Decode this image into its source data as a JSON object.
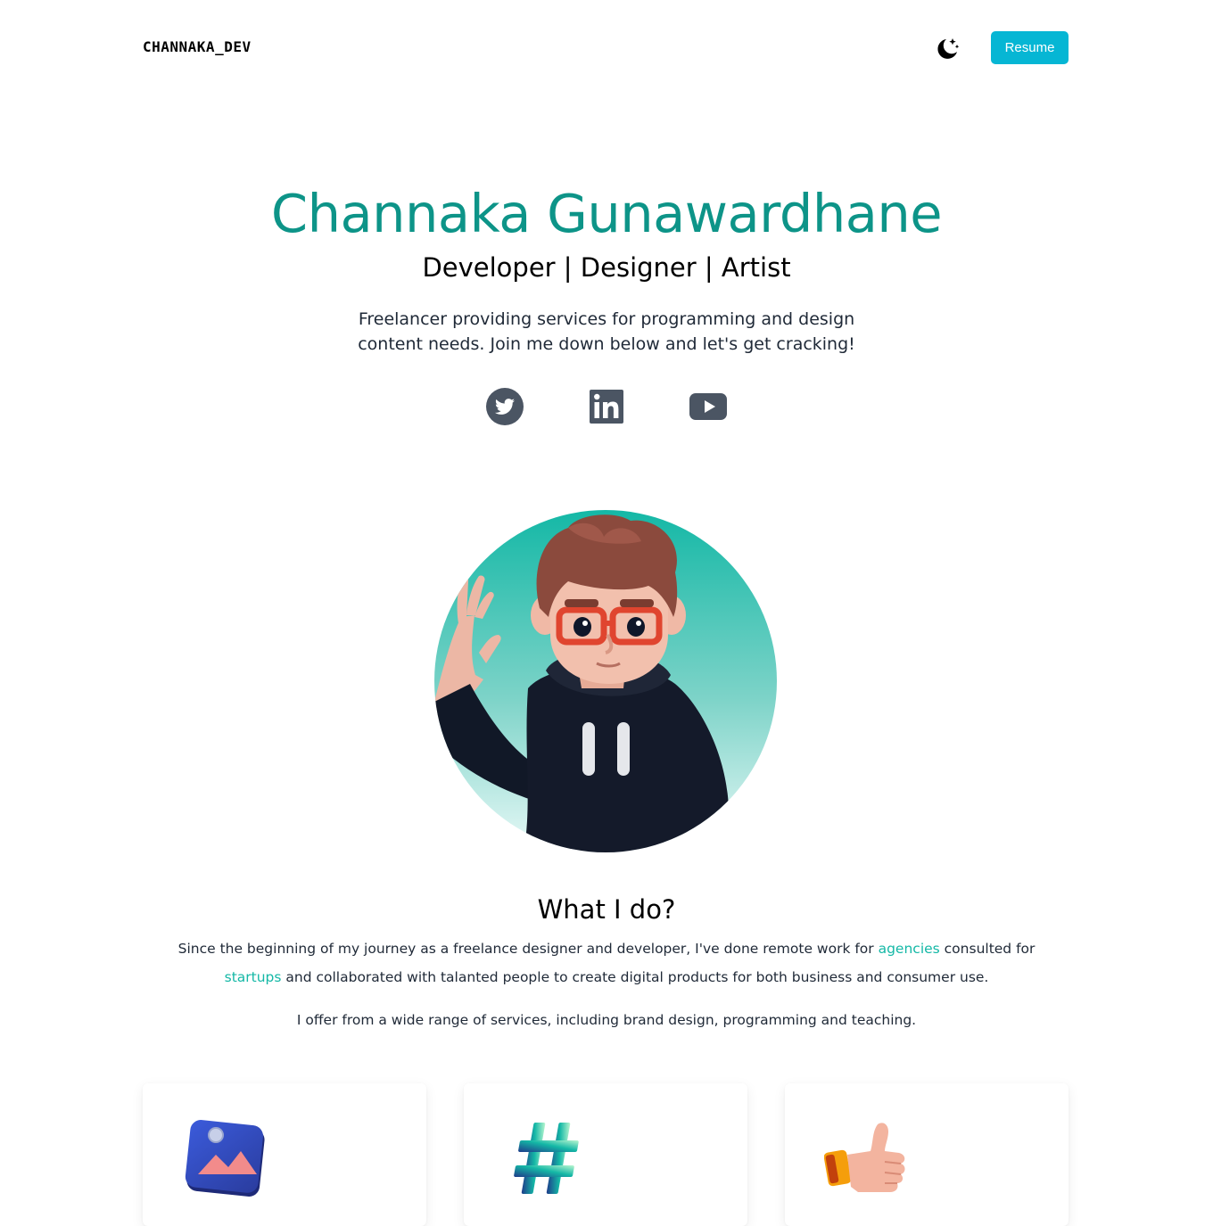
{
  "nav": {
    "logo": "CHANNAKA_DEV",
    "theme_icon": "moon-stars-icon",
    "resume_label": "Resume"
  },
  "hero": {
    "name": "Channaka Gunawardhane",
    "roles": "Developer | Designer | Artist",
    "description": "Freelancer providing services for programming and design content needs. Join me down below and let's get cracking!"
  },
  "socials": [
    {
      "icon": "twitter-icon"
    },
    {
      "icon": "linkedin-icon"
    },
    {
      "icon": "youtube-icon"
    }
  ],
  "about": {
    "title": "What I do?",
    "p1_before": "Since the beginning of my journey as a freelance designer and developer, I've done remote work for ",
    "p1_link1": "agencies",
    "p1_middle": " consulted for ",
    "p1_link2": "startups",
    "p1_after": " and collaborated with talanted people to create digital products for both business and consumer use.",
    "p2": "I offer from a wide range of services, including brand design, programming and teaching."
  },
  "services": [
    {
      "icon": "image-icon"
    },
    {
      "icon": "hashtag-icon"
    },
    {
      "icon": "thumbs-up-icon"
    }
  ],
  "colors": {
    "accent": "#0d9488",
    "button": "#06b6d4",
    "link": "#14b8a6"
  }
}
